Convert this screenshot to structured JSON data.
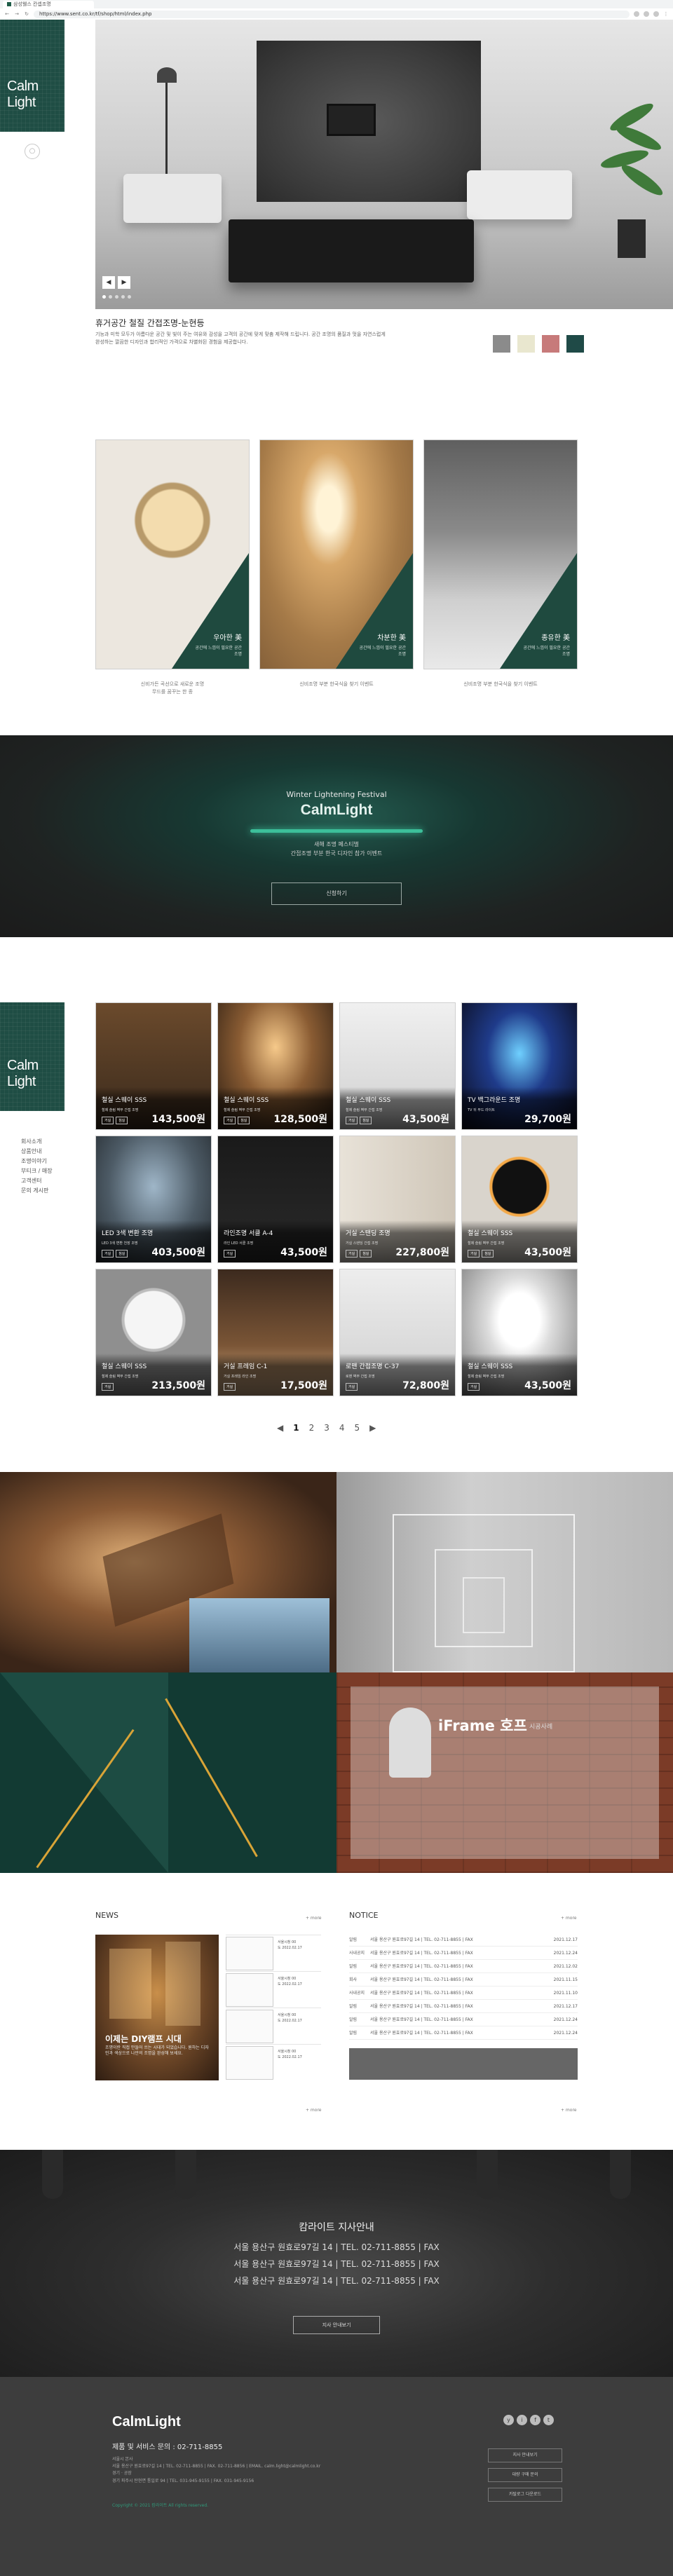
{
  "browser": {
    "tab_title": "삼성웰스 칸셉조명",
    "url": "https://www.sent.co.kr/tf/shop/html/index.php"
  },
  "brand": {
    "logo": "Calm Light",
    "accent": "#1f4d44"
  },
  "hero": {
    "title": "휴거공간 철질 간접조명-눈현등",
    "description": "기능과 미학 모두가 아름다운 공간 및 빛이 주는 여유와 감성을 고객의 공간에 맞게 맞춤 제작해 드립니다. 공간 조명의 품질과 멋을 자연스럽게 완성하는 깔끔한 디자인과 합리적인 가격으로 차별화된 경험을 제공합니다.",
    "prev_label": "◀",
    "next_label": "▶",
    "swatch_colors": [
      "#8b8b8b",
      "#e9e7cf",
      "#c77a7a",
      "#1f4a47"
    ]
  },
  "cards3": [
    {
      "title": "우아한 美",
      "subtitle": "공간에 느낌이 필요한 공간 조명",
      "caption_1": "신비가든 곡선으로 새로운 조명",
      "caption_2": "무드를 꿈꾸는 한 종"
    },
    {
      "title": "차분한 美",
      "subtitle": "공간에 느낌이 필요한 공간 조명",
      "caption_1": "신비조명 부분 한국식을 찾기 이벤트",
      "caption_2": ""
    },
    {
      "title": "종유한 美",
      "subtitle": "공간에 느낌이 필요한 공간 조명",
      "caption_1": "신비조명 부분 한국식을 찾기 이벤트",
      "caption_2": ""
    }
  ],
  "festival": {
    "title": "Winter Lightening Festival",
    "logo": "CalmLight",
    "sub1": "새해 조명 페스티벌",
    "sub2": "간접조명 부분 한국 디자인 참가 이벤트",
    "button": "신청하기"
  },
  "side_menu": [
    "회사소개",
    "상품안내",
    "조명이야기",
    "부티크 / 매장",
    "고객센터",
    "문의 게시판"
  ],
  "products": [
    {
      "name": "철실 스웨이 SSS",
      "desc": "철제 슬림 벽부 간접 조명",
      "tags": [
        "거실",
        "침실"
      ],
      "price": "143,500원"
    },
    {
      "name": "철실 스웨이 SSS",
      "desc": "철제 슬림 벽부 간접 조명",
      "tags": [
        "거실",
        "침실"
      ],
      "price": "128,500원"
    },
    {
      "name": "철실 스웨이 SSS",
      "desc": "철제 슬림 벽부 간접 조명",
      "tags": [
        "거실",
        "침실"
      ],
      "price": "43,500원"
    },
    {
      "name": "TV 백그라운드 조명",
      "desc": "TV 뒤 무드 라이트",
      "tags": [],
      "price": "29,700원"
    },
    {
      "name": "LED 3색 변환 조명",
      "desc": "LED 3색 변환 천장 조명",
      "tags": [
        "거실",
        "침실"
      ],
      "price": "403,500원"
    },
    {
      "name": "라인조명 서클 A-4",
      "desc": "라인 LED 서클 조명",
      "tags": [
        "거실"
      ],
      "price": "43,500원"
    },
    {
      "name": "거실 스탠딩 조명",
      "desc": "거실 스탠딩 간접 조명",
      "tags": [
        "거실",
        "침실"
      ],
      "price": "227,800원"
    },
    {
      "name": "철실 스웨이 SSS",
      "desc": "철제 슬림 벽부 간접 조명",
      "tags": [
        "거실",
        "침실"
      ],
      "price": "43,500원"
    },
    {
      "name": "철실 스웨이 SSS",
      "desc": "철제 슬림 벽부 간접 조명",
      "tags": [
        "거실"
      ],
      "price": "213,500원"
    },
    {
      "name": "거실 프레임 C-1",
      "desc": "거실 프레임 라인 조명",
      "tags": [
        "거실"
      ],
      "price": "17,500원"
    },
    {
      "name": "로맨 간접조명 C-37",
      "desc": "로맨 벽부 간접 조명",
      "tags": [
        "거실"
      ],
      "price": "72,800원"
    },
    {
      "name": "철실 스웨이 SSS",
      "desc": "철제 슬림 벽부 간접 조명",
      "tags": [
        "거실"
      ],
      "price": "43,500원"
    }
  ],
  "pager": {
    "prev": "◀",
    "pages": [
      "1",
      "2",
      "3",
      "4",
      "5"
    ],
    "next": "▶"
  },
  "gallery": {
    "label": "iFrame 호프",
    "sub": "시공사례"
  },
  "news": {
    "heading": "NEWS",
    "more": "+ more",
    "main_title": "이제는 DIY램프 시대",
    "main_desc": "조명이란 직접 만들어 쓰는 시대가 되었습니다. 원하는 디자인과 색상으로 나만의 조명을 완성해 보세요.",
    "side_items": [
      {
        "line1": "서울시청 00",
        "line2": "도 2022.02.17"
      },
      {
        "line1": "서울시청 00",
        "line2": "도 2022.02.17"
      },
      {
        "line1": "서울시청 00",
        "line2": "도 2022.02.17"
      },
      {
        "line1": "서울시청 00",
        "line2": "도 2022.02.17"
      }
    ]
  },
  "notice": {
    "heading": "NOTICE",
    "more": "+ more",
    "rows": [
      {
        "cat": "알림",
        "text": "서울 용산구 원효로97길 14 | TEL. 02-711-8855 | FAX",
        "date": "2021.12.17"
      },
      {
        "cat": "사내공지",
        "text": "서울 용산구 원효로97길 14 | TEL. 02-711-8855 | FAX",
        "date": "2021.12.24"
      },
      {
        "cat": "알림",
        "text": "서울 용산구 원효로97길 14 | TEL. 02-711-8855 | FAX",
        "date": "2021.12.02"
      },
      {
        "cat": "회사",
        "text": "서울 용산구 원효로97길 14 | TEL. 02-711-8855 | FAX",
        "date": "2021.11.15"
      },
      {
        "cat": "사내공지",
        "text": "서울 용산구 원효로97길 14 | TEL. 02-711-8855 | FAX",
        "date": "2021.11.10"
      },
      {
        "cat": "알림",
        "text": "서울 용산구 원효로97길 14 | TEL. 02-711-8855 | FAX",
        "date": "2021.12.17"
      },
      {
        "cat": "알림",
        "text": "서울 용산구 원효로97길 14 | TEL. 02-711-8855 | FAX",
        "date": "2021.12.24"
      },
      {
        "cat": "알림",
        "text": "서울 용산구 원효로97길 14 | TEL. 02-711-8855 | FAX",
        "date": "2021.12.24"
      }
    ],
    "bottom_more_left": "+ more",
    "bottom_more_right": "+ more"
  },
  "branch": {
    "title": "캄라이트 지사안내",
    "lines": [
      "서울 용산구 원효로97길 14 | TEL. 02-711-8855 | FAX",
      "서울 용산구 원효로97길 14 | TEL. 02-711-8855 | FAX",
      "서울 용산구 원효로97길 14 | TEL. 02-711-8855 | FAX"
    ],
    "button": "지사 안내보기"
  },
  "footer": {
    "logo": "CalmLight",
    "phone": "제품 및 서비스 문의 : 02-711-8855",
    "info_1": "서울시 본사",
    "info_2": "서울 용산구 원효로97길 14 | TEL. 02-711-8855 | FAX. 02-711-8856 | EMAIL. calm.light@calmlight.co.kr",
    "info_3": "경기 · 공장",
    "info_4": "경기 파주시 탄현면 통일로 94 | TEL. 031-945-9155 | FAX. 031-945-9156",
    "copyright": "Copyright © 2021 캄라이트 All rights reserved.",
    "buttons": [
      "지사 안내보기",
      "대량 구매 문의",
      "카탈로그 다운로드"
    ],
    "social": [
      "y",
      "i",
      "f",
      "t"
    ]
  }
}
